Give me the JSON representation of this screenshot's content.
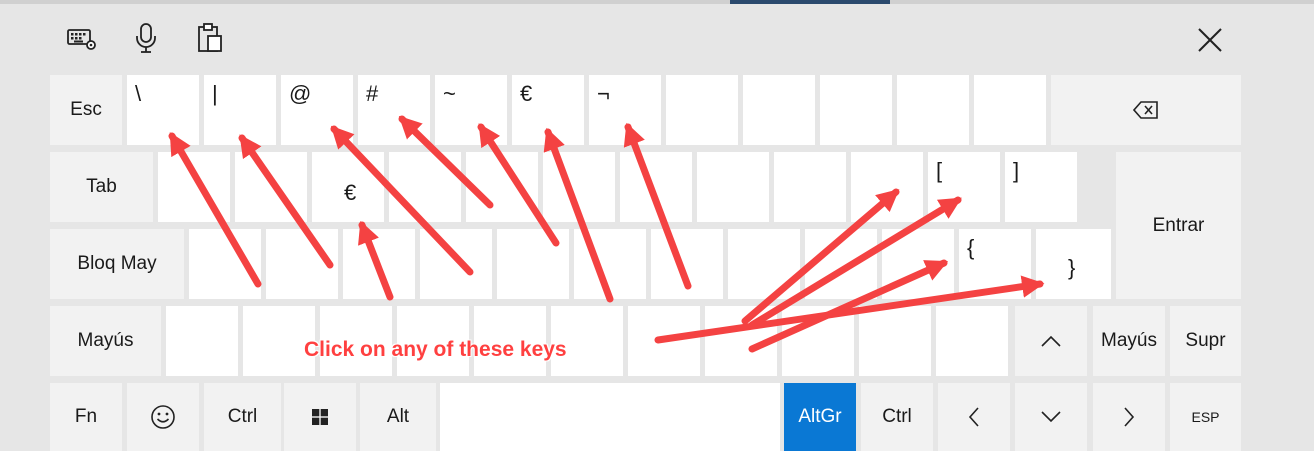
{
  "toolbar": {
    "icons": [
      "keyboard-settings-icon",
      "microphone-icon",
      "clipboard-icon",
      "close-icon"
    ]
  },
  "row1": {
    "esc": "Esc",
    "symbols": [
      "\\",
      "|",
      "@",
      "#",
      "~",
      "€",
      "¬"
    ],
    "backspace_icon": "backspace-icon"
  },
  "row2": {
    "tab": "Tab",
    "euro": "€",
    "bracket_open": "[",
    "bracket_close": "]",
    "enter": "Entrar"
  },
  "row3": {
    "caps": "Bloq May",
    "brace_open": "{",
    "brace_close": "}"
  },
  "row4": {
    "shift_left": "Mayús",
    "shift_right": "Mayús",
    "delete": "Supr",
    "up_icon": "chevron-up-icon"
  },
  "row5": {
    "fn": "Fn",
    "emoji_icon": "smiley-icon",
    "ctrl_left": "Ctrl",
    "windows_icon": "windows-icon",
    "alt": "Alt",
    "altgr": "AltGr",
    "ctrl_right": "Ctrl",
    "left_icon": "chevron-left-icon",
    "down_icon": "chevron-down-icon",
    "right_icon": "chevron-right-icon",
    "lang": "ESP"
  },
  "annotation": {
    "text": "Click on any of these keys"
  },
  "colors": {
    "accent": "#0a78d4",
    "arrow": "#f44242",
    "key": "#ffffff",
    "key_special": "#f2f2f2",
    "background": "#e6e6e6"
  }
}
